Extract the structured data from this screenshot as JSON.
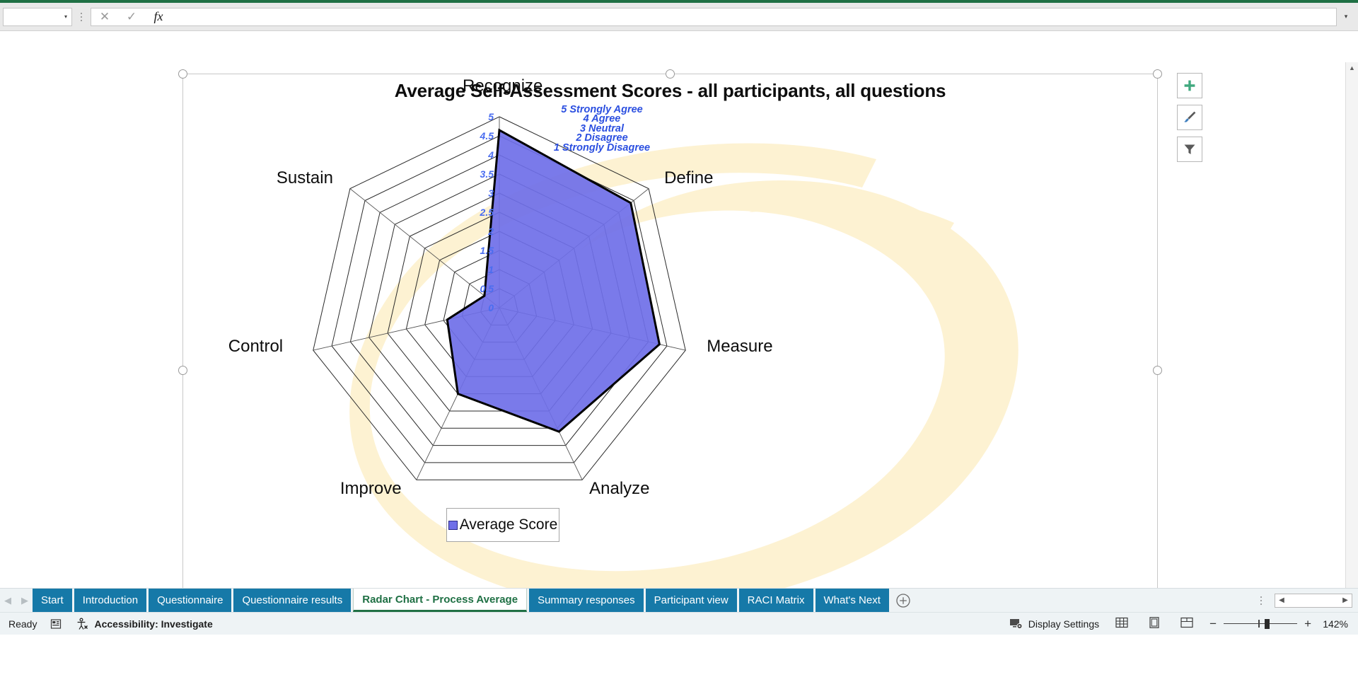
{
  "formula_bar": {
    "name_box_value": "",
    "name_box_caret": "▾",
    "cancel_icon": "✕",
    "confirm_icon": "✓",
    "fx_label": "fx",
    "formula_value": "",
    "expand_caret": "▾"
  },
  "chart": {
    "title": "Average Self-Assessment Scores - all participants, all questions",
    "scale_legend": [
      "5 Strongly Agree",
      "4 Agree",
      "3 Neutral",
      "2 Disagree",
      "1 Strongly Disagree"
    ],
    "legend_series_label": "Average Score",
    "buttons": [
      {
        "name": "chart-elements-button",
        "icon": "plus-icon"
      },
      {
        "name": "chart-styles-button",
        "icon": "paintbrush-icon"
      },
      {
        "name": "chart-filters-button",
        "icon": "funnel-icon"
      }
    ],
    "colors": {
      "series_fill": "#6f6fe8",
      "series_line": "#000000",
      "tick_text": "#4a6df0",
      "scale_legend_text": "#2b4fe0",
      "watermark": "#fdf2d2"
    }
  },
  "chart_data": {
    "type": "radar",
    "title": "Average Self-Assessment Scores - all participants, all questions",
    "series": [
      {
        "name": "Average Score",
        "values": [
          4.65,
          4.4,
          4.3,
          3.6,
          2.5,
          1.4,
          0.5
        ]
      }
    ],
    "categories": [
      "Recognize",
      "Define",
      "Measure",
      "Analyze",
      "Improve",
      "Control",
      "Sustain"
    ],
    "ticks": [
      "0",
      "0.5",
      "1",
      "1.5",
      "2",
      "2.5",
      "3",
      "3.5",
      "4",
      "4.5",
      "5"
    ],
    "rlim": [
      0,
      5
    ],
    "rstep": 0.5,
    "legend": "Average Score",
    "legend_position": "bottom",
    "grid": true,
    "scale_meaning": {
      "5": "Strongly Agree",
      "4": "Agree",
      "3": "Neutral",
      "2": "Disagree",
      "1": "Strongly Disagree"
    }
  },
  "sheet_tabs": {
    "nav_prev": "◀",
    "nav_next": "▶",
    "items": [
      {
        "label": "Start",
        "active": false
      },
      {
        "label": "Introduction",
        "active": false
      },
      {
        "label": "Questionnaire",
        "active": false
      },
      {
        "label": "Questionnaire results",
        "active": false
      },
      {
        "label": "Radar Chart - Process Average",
        "active": true
      },
      {
        "label": "Summary responses",
        "active": false
      },
      {
        "label": "Participant view",
        "active": false
      },
      {
        "label": "RACI Matrix",
        "active": false
      },
      {
        "label": "What's Next",
        "active": false
      }
    ],
    "add_sheet_icon": "plus-circle-icon",
    "hscroll_left": "◀",
    "hscroll_right": "▶"
  },
  "status_bar": {
    "mode": "Ready",
    "macro_icon": "record-macro-icon",
    "accessibility": "Accessibility: Investigate",
    "display_settings": "Display Settings",
    "view_normal_icon": "normal-view-icon",
    "view_pagelayout_icon": "page-layout-view-icon",
    "view_pagebreak_icon": "page-break-view-icon",
    "zoom_out": "−",
    "zoom_in": "+",
    "zoom_level": "142%"
  }
}
